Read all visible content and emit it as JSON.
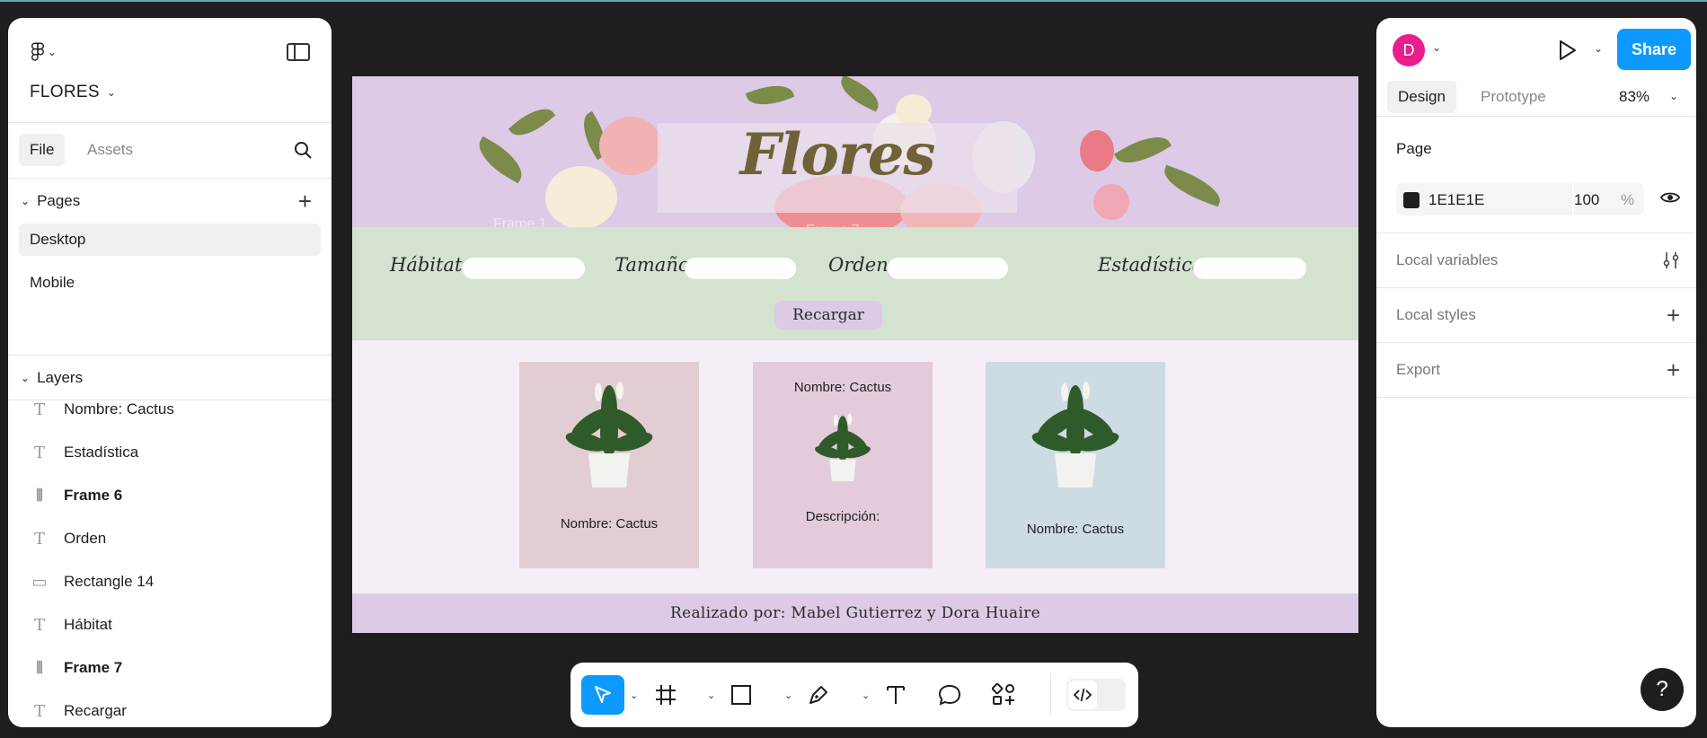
{
  "project": {
    "name": "FLORES"
  },
  "left_panel": {
    "tabs": {
      "file": "File",
      "assets": "Assets"
    },
    "pages_header": "Pages",
    "pages": [
      "Desktop",
      "Mobile"
    ],
    "layers_header": "Layers",
    "layers": [
      {
        "name": "Nombre: Cactus",
        "type": "text"
      },
      {
        "name": "Estadística",
        "type": "text"
      },
      {
        "name": "Frame 6",
        "type": "frame"
      },
      {
        "name": "Orden",
        "type": "text"
      },
      {
        "name": "Rectangle 14",
        "type": "rectangle"
      },
      {
        "name": "Hábitat",
        "type": "text"
      },
      {
        "name": "Frame 7",
        "type": "frame"
      },
      {
        "name": "Recargar",
        "type": "text"
      }
    ]
  },
  "right_panel": {
    "avatar_initial": "D",
    "share_label": "Share",
    "tabs": {
      "design": "Design",
      "prototype": "Prototype"
    },
    "zoom": "83%",
    "page_label": "Page",
    "page_color": "1E1E1E",
    "page_opacity": "100",
    "opacity_unit": "%",
    "rows": [
      "Local variables",
      "Local styles",
      "Export"
    ]
  },
  "canvas": {
    "title": "Flores",
    "ghost_labels": [
      "Frame 1",
      "Frame 7"
    ],
    "filters": [
      "Hábitat",
      "Tamaño",
      "Orden",
      "Estadística"
    ],
    "reload_button": "Recargar",
    "cards": [
      {
        "top_text": "",
        "bottom_text": "Nombre: Cactus",
        "bg": "#e2cdd3"
      },
      {
        "top_text": "Nombre: Cactus",
        "bottom_text": "Descripción:",
        "bg": "#e3cbdc"
      },
      {
        "top_text": "",
        "bottom_text": "Nombre: Cactus",
        "bg": "#cddbe3"
      }
    ],
    "footer": "Realizado por: Mabel Gutierrez y Dora Huaire"
  },
  "colors": {
    "accent": "#0d99ff",
    "canvas_bg": "#1E1E1E",
    "banner": "#dccae6",
    "filter_bar": "#d3e3cf"
  },
  "toolbar": {
    "tools": [
      "move-tool",
      "frame-tool",
      "shape-tool",
      "pen-tool",
      "text-tool",
      "comment-tool",
      "actions-tool"
    ],
    "dev_mode": "dev-mode-toggle"
  }
}
